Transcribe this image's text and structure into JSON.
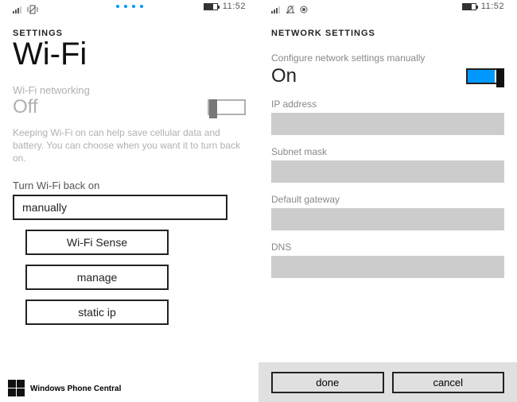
{
  "left": {
    "statusbar": {
      "time": "11:52"
    },
    "section_header": "SETTINGS",
    "page_title": "Wi-Fi",
    "networking_label": "Wi-Fi networking",
    "networking_value": "Off",
    "help_text": "Keeping Wi-Fi on can help save cellular data and battery. You can choose when you want it to turn back on.",
    "turn_back_label": "Turn Wi-Fi back on",
    "turn_back_value": "manually",
    "buttons": {
      "wifi_sense": "Wi-Fi Sense",
      "manage": "manage",
      "static_ip": "static ip"
    },
    "watermark": "Windows Phone Central"
  },
  "right": {
    "statusbar": {
      "time": "11:52"
    },
    "section_header": "NETWORK SETTINGS",
    "configure_label": "Configure network settings manually",
    "configure_value": "On",
    "fields": {
      "ip_label": "IP address",
      "ip_value": "",
      "subnet_label": "Subnet mask",
      "subnet_value": "",
      "gateway_label": "Default gateway",
      "gateway_value": "",
      "dns_label": "DNS",
      "dns_value": ""
    },
    "appbar": {
      "done": "done",
      "cancel": "cancel"
    }
  }
}
